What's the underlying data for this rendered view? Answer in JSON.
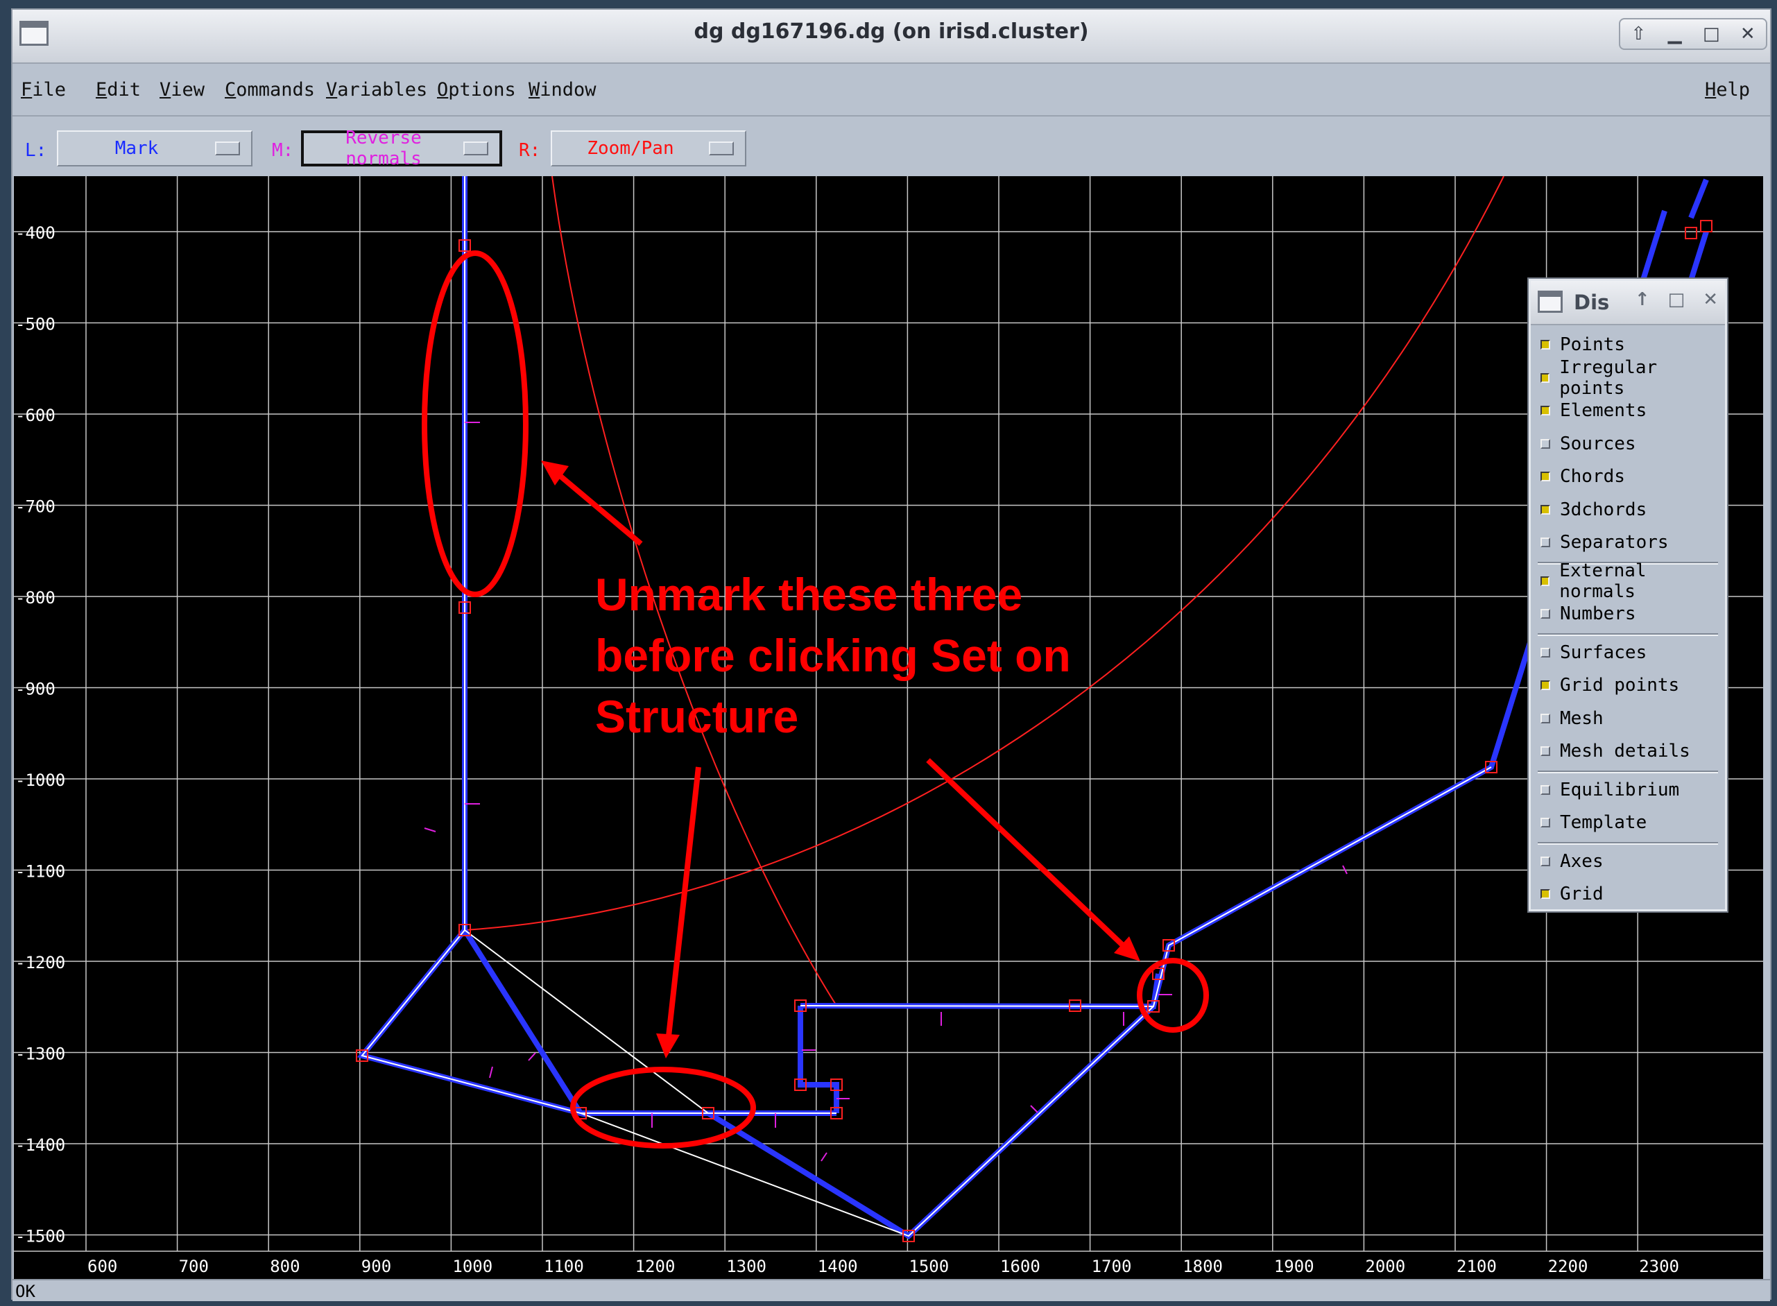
{
  "window": {
    "title": "dg dg167196.dg (on irisd.cluster)",
    "controls": [
      "up-arrow-icon",
      "minimize-icon",
      "maximize-icon",
      "close-icon"
    ]
  },
  "menubar": {
    "items": [
      "File",
      "Edit",
      "View",
      "Commands",
      "Variables",
      "Options",
      "Window"
    ],
    "help": "Help"
  },
  "toolbar": {
    "left": {
      "label": "L:",
      "value": "Mark",
      "color": "#1a2cff"
    },
    "middle": {
      "label": "M:",
      "value": "Reverse normals",
      "color": "#e020e0"
    },
    "right": {
      "label": "R:",
      "value": "Zoom/Pan",
      "color": "#ff1010"
    }
  },
  "plot": {
    "y_ticks": [
      "-400",
      "-500",
      "-600",
      "-700",
      "-800",
      "-900",
      "-1000",
      "-1100",
      "-1200",
      "-1300",
      "-1400",
      "-1500"
    ],
    "x_ticks": [
      "600",
      "700",
      "800",
      "900",
      "1000",
      "1100",
      "1200",
      "1300",
      "1400",
      "1500",
      "1600",
      "1700",
      "1800",
      "1900",
      "2000",
      "2100",
      "2200",
      "2300"
    ],
    "structure_color": "#2a35ff",
    "annotation_color": "#ff0000"
  },
  "annotation": {
    "lines": [
      "Unmark these three",
      "before clicking Set on",
      "Structure"
    ]
  },
  "display_panel": {
    "title": "Dis",
    "groups": [
      [
        {
          "label": "Points",
          "checked": true
        },
        {
          "label": "Irregular points",
          "checked": true
        },
        {
          "label": "Elements",
          "checked": true
        },
        {
          "label": "Sources",
          "checked": false
        },
        {
          "label": "Chords",
          "checked": true
        },
        {
          "label": "3dchords",
          "checked": true
        },
        {
          "label": "Separators",
          "checked": false
        }
      ],
      [
        {
          "label": "External normals",
          "checked": true
        },
        {
          "label": "Numbers",
          "checked": false
        }
      ],
      [
        {
          "label": "Surfaces",
          "checked": false
        },
        {
          "label": "Grid points",
          "checked": true
        },
        {
          "label": "Mesh",
          "checked": false
        },
        {
          "label": "Mesh details",
          "checked": false
        }
      ],
      [
        {
          "label": "Equilibrium",
          "checked": false
        },
        {
          "label": "Template",
          "checked": false
        }
      ],
      [
        {
          "label": "Axes",
          "checked": false
        },
        {
          "label": "Grid",
          "checked": true
        }
      ]
    ]
  },
  "status": {
    "text": "OK"
  }
}
